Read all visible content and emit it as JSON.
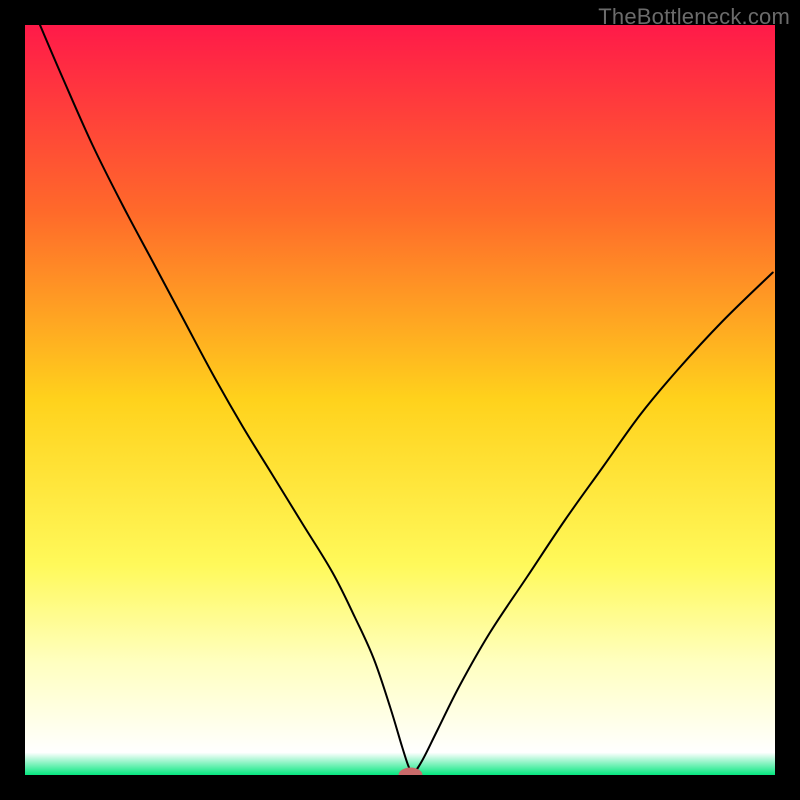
{
  "watermark": "TheBottleneck.com",
  "chart_data": {
    "type": "line",
    "title": "",
    "xlabel": "",
    "ylabel": "",
    "xlim": [
      0,
      100
    ],
    "ylim": [
      0,
      100
    ],
    "grid": false,
    "legend": false,
    "background_gradient_stops": [
      {
        "offset": 0.0,
        "color": "#ff1a49"
      },
      {
        "offset": 0.25,
        "color": "#ff6a2a"
      },
      {
        "offset": 0.5,
        "color": "#ffd21c"
      },
      {
        "offset": 0.72,
        "color": "#fff95a"
      },
      {
        "offset": 0.85,
        "color": "#ffffc0"
      },
      {
        "offset": 0.97,
        "color": "#ffffff"
      },
      {
        "offset": 1.0,
        "color": "#05e77f"
      }
    ],
    "series": [
      {
        "name": "bottleneck-curve",
        "stroke": "#000000",
        "stroke_width": 2.0,
        "x": [
          2,
          5,
          9,
          13,
          17,
          21,
          25,
          29,
          33,
          37,
          41,
          44,
          46.5,
          48.7,
          50.3,
          51.2,
          51.8,
          53,
          55,
          58,
          62,
          67,
          72,
          77,
          82,
          87,
          93,
          99.7
        ],
        "y": [
          100,
          93,
          84,
          76,
          68.5,
          61,
          53.5,
          46.5,
          40,
          33.5,
          27,
          21,
          15.5,
          9,
          3.7,
          1,
          0.3,
          2,
          6,
          12,
          19,
          26.5,
          34,
          41,
          48,
          54,
          60.5,
          67
        ]
      }
    ],
    "marker": {
      "name": "optimum-point",
      "cx": 51.4,
      "cy": 0.0,
      "rx": 1.6,
      "ry": 1.0,
      "fill": "#c96a6a"
    }
  }
}
